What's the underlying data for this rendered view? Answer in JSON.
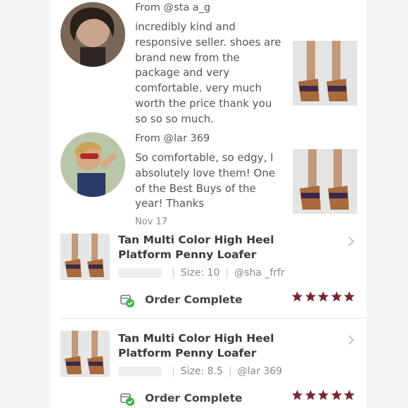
{
  "reviews": [
    {
      "author": "From @sta a_g",
      "text": "incredibly kind and responsive seller. shoes are brand new from the package and very comfortable. very much worth the price thank you so so so much.",
      "date": ""
    },
    {
      "author": "From @lar 369",
      "text": "So comfortable, so edgy, I absolutely love them! One of the Best Buys of the year! Thanks",
      "date": "Nov 17"
    }
  ],
  "orders": [
    {
      "title": "Tan Multi Color High Heel Platform Penny Loafer",
      "size": "Size: 10",
      "buyer": "@sha _frfr",
      "status": "Order Complete",
      "rating": 5
    },
    {
      "title": "Tan Multi Color High Heel Platform Penny Loafer",
      "size": "Size: 8.5",
      "buyer": "@lar 369",
      "status": "Order Complete",
      "rating": 5
    }
  ],
  "colors": {
    "star": "#7a2530",
    "check": "#3bb34a"
  }
}
